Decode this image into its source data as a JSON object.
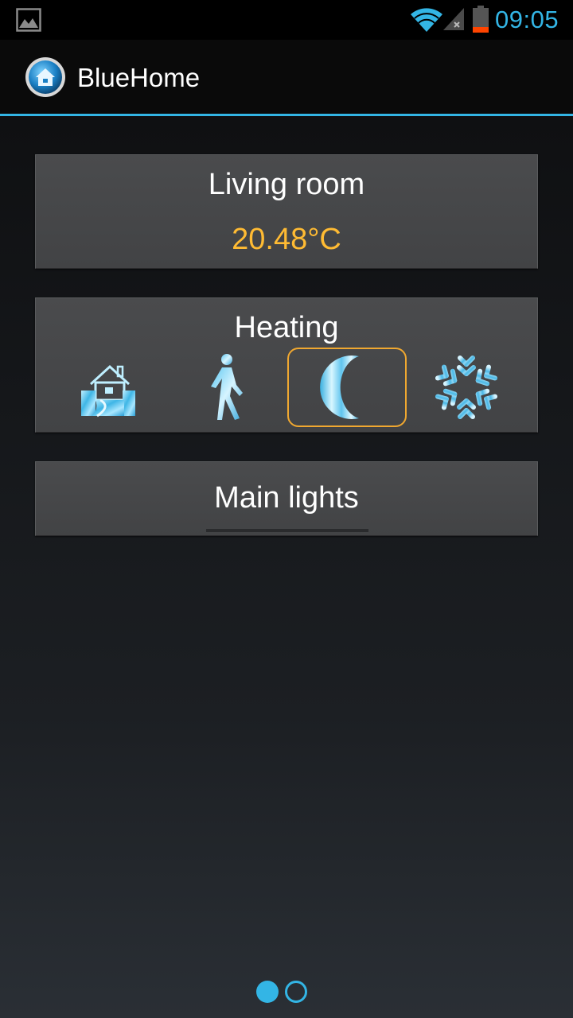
{
  "status_bar": {
    "time": "09:05",
    "icons": [
      "image-notification-icon",
      "wifi-icon",
      "signal-icon",
      "battery-icon"
    ]
  },
  "action_bar": {
    "title": "BlueHome",
    "icon": "bluehome-app-icon"
  },
  "temperature_card": {
    "room": "Living room",
    "temperature": "20.48°C"
  },
  "heating_card": {
    "title": "Heating",
    "modes": [
      {
        "icon": "home-icon",
        "selected": false
      },
      {
        "icon": "walking-person-icon",
        "selected": false
      },
      {
        "icon": "moon-icon",
        "selected": true
      },
      {
        "icon": "snowflake-icon",
        "selected": false
      }
    ]
  },
  "lights_card": {
    "title": "Main lights"
  },
  "pager": {
    "pages": 2,
    "current": 1
  },
  "colors": {
    "accent": "#33b5e5",
    "temperature": "#ffbb33",
    "selection": "#f0a830"
  }
}
